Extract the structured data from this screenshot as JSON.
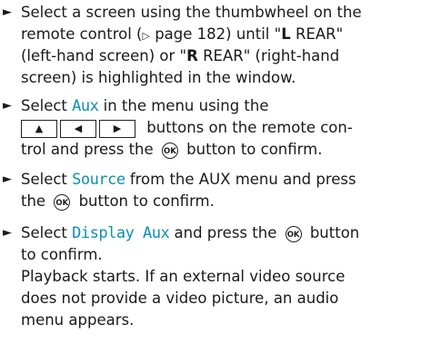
{
  "steps": [
    {
      "lines": [
        [
          "Select a screen using the thumbwheel on the"
        ],
        [
          "remote control (",
          "▷",
          " page 182) until \"",
          "L",
          " REAR\""
        ],
        [
          "(left-hand screen) or \"",
          "R",
          " REAR\" (right-hand"
        ],
        [
          "screen) is highlighted in the window."
        ]
      ]
    }
  ],
  "s1": {
    "l1": "Select a screen using the thumbwheel on the",
    "l2a": "remote control (",
    "l2_tri": "▷",
    "l2b": " page 182) until \"",
    "l2_L": "L",
    "l2c": " REAR\"",
    "l3a": "(left-hand screen) or \"",
    "l3_R": "R",
    "l3b": " REAR\" (right-hand",
    "l4": "screen) is highlighted in the window."
  },
  "s2": {
    "l1a": "Select ",
    "l1_hl": "Aux",
    "l1b": " in the menu using the",
    "btn_up": "▲",
    "btn_left": "◀",
    "btn_right": "▶",
    "l2b": " buttons on the remote con-",
    "l3a": "trol and press the ",
    "ok": "OK",
    "l3b": " button to confirm."
  },
  "s3": {
    "l1a": "Select ",
    "l1_hl": "Source",
    "l1b": " from the AUX menu and press",
    "l2a": "the ",
    "ok": "OK",
    "l2b": " button to confirm."
  },
  "s4": {
    "l1a": "Select ",
    "l1_hl": "Display Aux",
    "l1b": " and press the ",
    "ok": "OK",
    "l1c": " button",
    "l2": "to confirm.",
    "l3": "Playback starts. If an external video source",
    "l4": "does not provide a video picture, an audio",
    "l5": "menu appears."
  },
  "marker": "►"
}
